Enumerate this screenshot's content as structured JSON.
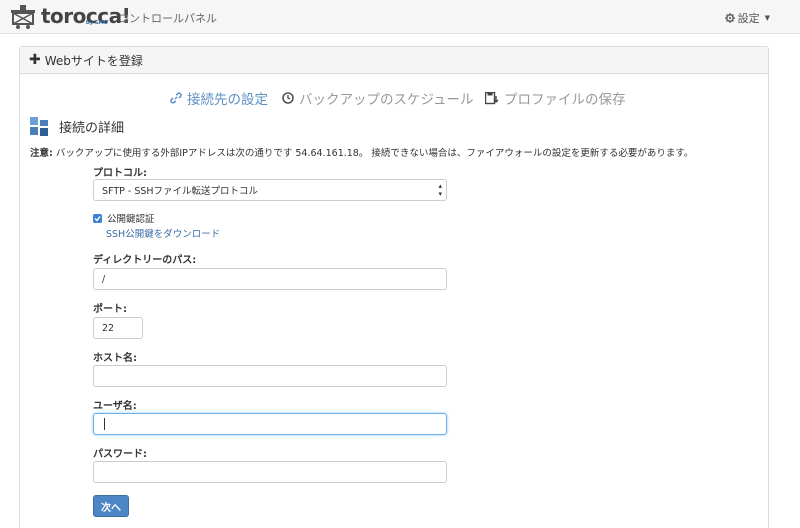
{
  "header": {
    "brand": "torocca!",
    "brand_sub": "by GMO",
    "app_title": "コントロールパネル",
    "settings_label": "設定"
  },
  "panel": {
    "heading": "Webサイトを登録"
  },
  "steps": [
    {
      "label": "接続先の設定",
      "icon": "link-icon",
      "state": "active"
    },
    {
      "label": "バックアップのスケジュール",
      "icon": "clock-icon",
      "state": "inactive"
    },
    {
      "label": "プロファイルの保存",
      "icon": "save-icon",
      "state": "inactive"
    }
  ],
  "section": {
    "title": "接続の詳細"
  },
  "note": {
    "prefix": "注意:",
    "text": " バックアップに使用する外部IPアドレスは次の通りです 54.64.161.18。 接続できない場合は、ファイアウォールの設定を更新する必要があります。"
  },
  "form": {
    "protocol_label": "プロトコル:",
    "protocol_value": "SFTP - SSHファイル転送プロトコル",
    "pubkey_label": "公開鍵認証",
    "pubkey_checked": true,
    "download_link": "SSH公開鍵をダウンロード",
    "directory_label": "ディレクトリーのパス:",
    "directory_value": "/",
    "port_label": "ポート:",
    "port_value": "22",
    "host_label": "ホスト名:",
    "host_value": "",
    "user_label": "ユーザ名:",
    "user_value": "",
    "password_label": "パスワード:",
    "password_value": "",
    "next_button": "次へ"
  },
  "colors": {
    "accent": "#5d8fc4",
    "button": "#4d86c4",
    "link": "#3a6ea5"
  }
}
